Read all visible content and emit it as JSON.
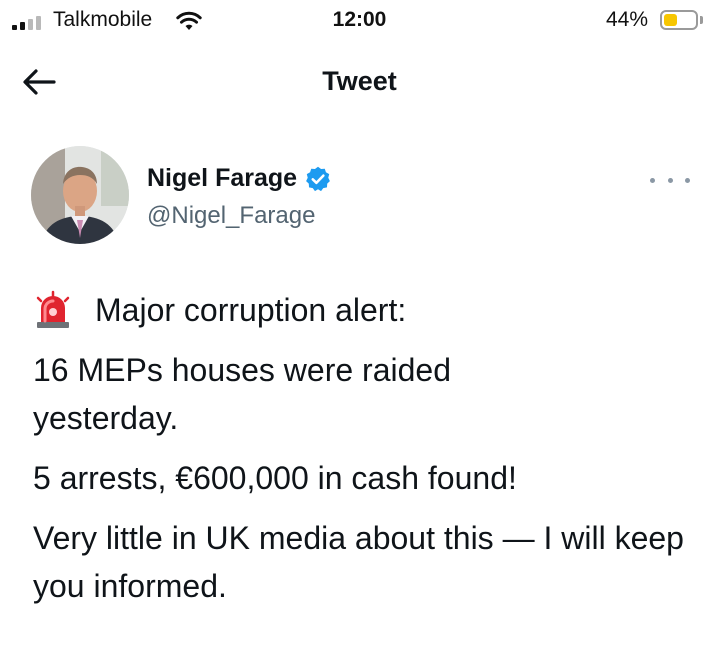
{
  "status_bar": {
    "carrier": "Talkmobile",
    "time": "12:00",
    "battery_percent": "44%",
    "battery_level": 0.44,
    "battery_color": "#f7c600",
    "signal_icon": "signal-bars-icon",
    "wifi_icon": "wifi-icon"
  },
  "nav": {
    "back_icon": "back-arrow-icon",
    "title": "Tweet"
  },
  "author": {
    "display_name": "Nigel Farage",
    "verified": true,
    "verified_color": "#1d9bf0",
    "handle": "@Nigel_Farage",
    "more_icon": "more-options-icon"
  },
  "tweet": {
    "alert_icon": "police-siren-icon",
    "line1": "Major corruption alert:",
    "line2": "16 MEPs houses were raided yesterday.",
    "line3": "5 arrests, €600,000 in cash found!",
    "line4": "Very little in UK media about this — I will keep you informed."
  }
}
